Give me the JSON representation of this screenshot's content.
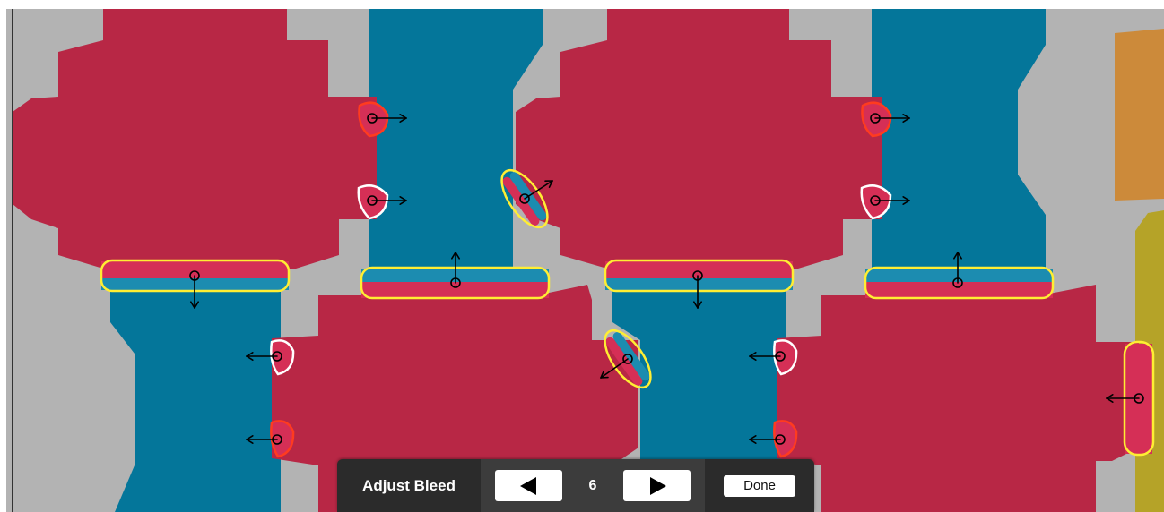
{
  "toolbar": {
    "title": "Adjust Bleed",
    "prev_icon": "triangle-left-icon",
    "value": "6",
    "next_icon": "triangle-right-icon",
    "done_label": "Done"
  },
  "colors": {
    "background": "#b3b3b3",
    "panel_red": "#b82745",
    "panel_blue": "#04769a",
    "bleed_red": "#d52f56",
    "bleed_blue": "#1c8cb0",
    "handle_yellow": "#ffee33",
    "handle_red": "#ff3b1f",
    "handle_white": "#ffffff",
    "edge_orange": "#cc8a3a",
    "edge_olive": "#b5a328",
    "toolbar_bg": "#2b2b2b"
  }
}
